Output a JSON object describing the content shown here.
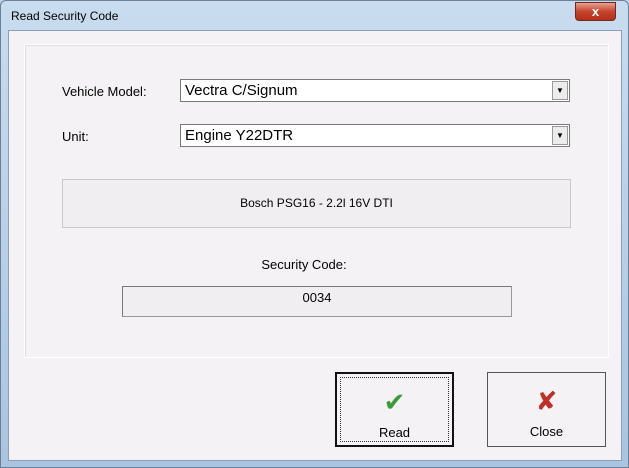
{
  "window": {
    "title": "Read Security Code",
    "close_label": "x"
  },
  "form": {
    "vehicle_model_label": "Vehicle Model:",
    "vehicle_model_value": "Vectra C/Signum",
    "unit_label": "Unit:",
    "unit_value": "Engine Y22DTR",
    "info_text": "Bosch PSG16 - 2.2l 16V DTI",
    "security_code_label": "Security Code:",
    "security_code_value": "0034"
  },
  "buttons": {
    "read": "Read",
    "close": "Close"
  },
  "colors": {
    "check": "#3c9a3c",
    "cross": "#c0302a"
  }
}
